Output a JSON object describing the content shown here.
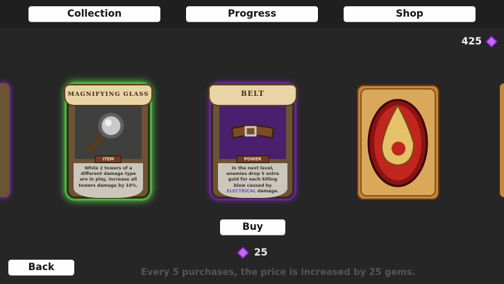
{
  "nav": {
    "collection": "Collection",
    "progress": "Progress",
    "shop": "Shop"
  },
  "wallet": {
    "gems": "425",
    "icon": "purple-gem-icon"
  },
  "cards": [
    {
      "title": "MAGNIFYING GLASS",
      "type": "ITEM",
      "description": "While 2 towers of a different damage type are in play, increase all towers damage by 10%.",
      "state": "selected",
      "icon": "magnifying-glass-icon"
    },
    {
      "title": "BELT",
      "type": "POWER",
      "description_before": "In the next level, enemies drop 5 extra gold for each killing blow caused by ",
      "description_highlight": "ELECTRICAL",
      "description_after": " damage.",
      "icon": "belt-icon"
    },
    {
      "title": "",
      "state": "face-down",
      "icon": "flame-emblem-icon"
    }
  ],
  "actions": {
    "buy": "Buy",
    "back": "Back"
  },
  "price": {
    "amount": "25",
    "icon": "purple-gem-icon"
  },
  "footer_note": "Every 5 purchases, the price is increased by 25 gems.",
  "colors": {
    "background": "#262626",
    "selected_glow": "#4fbf45",
    "rare_glow": "#6c2aa0",
    "electrical": "#7b4bc3"
  }
}
